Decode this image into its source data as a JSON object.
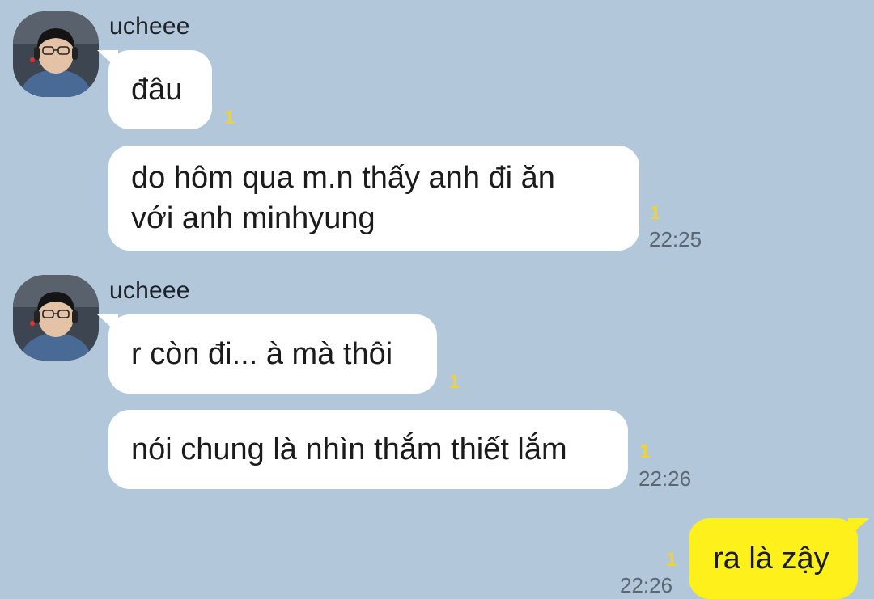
{
  "theme": {
    "background": "#b2c7da",
    "incoming_bubble": "#ffffff",
    "outgoing_bubble": "#fef01b",
    "unread_color": "#f2d233"
  },
  "messages": [
    {
      "sender": "ucheee",
      "avatar_icon": "profile-photo-icon",
      "bubbles": [
        {
          "text": "đâu",
          "unread": "1",
          "time": ""
        },
        {
          "lines": [
            "do hôm qua m.n thấy anh đi ăn",
            "với anh minhyung"
          ],
          "unread": "1",
          "time": "22:25"
        }
      ]
    },
    {
      "sender": "ucheee",
      "avatar_icon": "profile-photo-icon",
      "bubbles": [
        {
          "text": "r còn đi... à mà thôi",
          "unread": "1",
          "time": ""
        },
        {
          "text": "nói chung là nhìn thắm thiết lắm",
          "unread": "1",
          "time": "22:26"
        }
      ]
    }
  ],
  "outgoing": [
    {
      "text": "ra là zậy",
      "unread": "1",
      "time": "22:26"
    }
  ]
}
